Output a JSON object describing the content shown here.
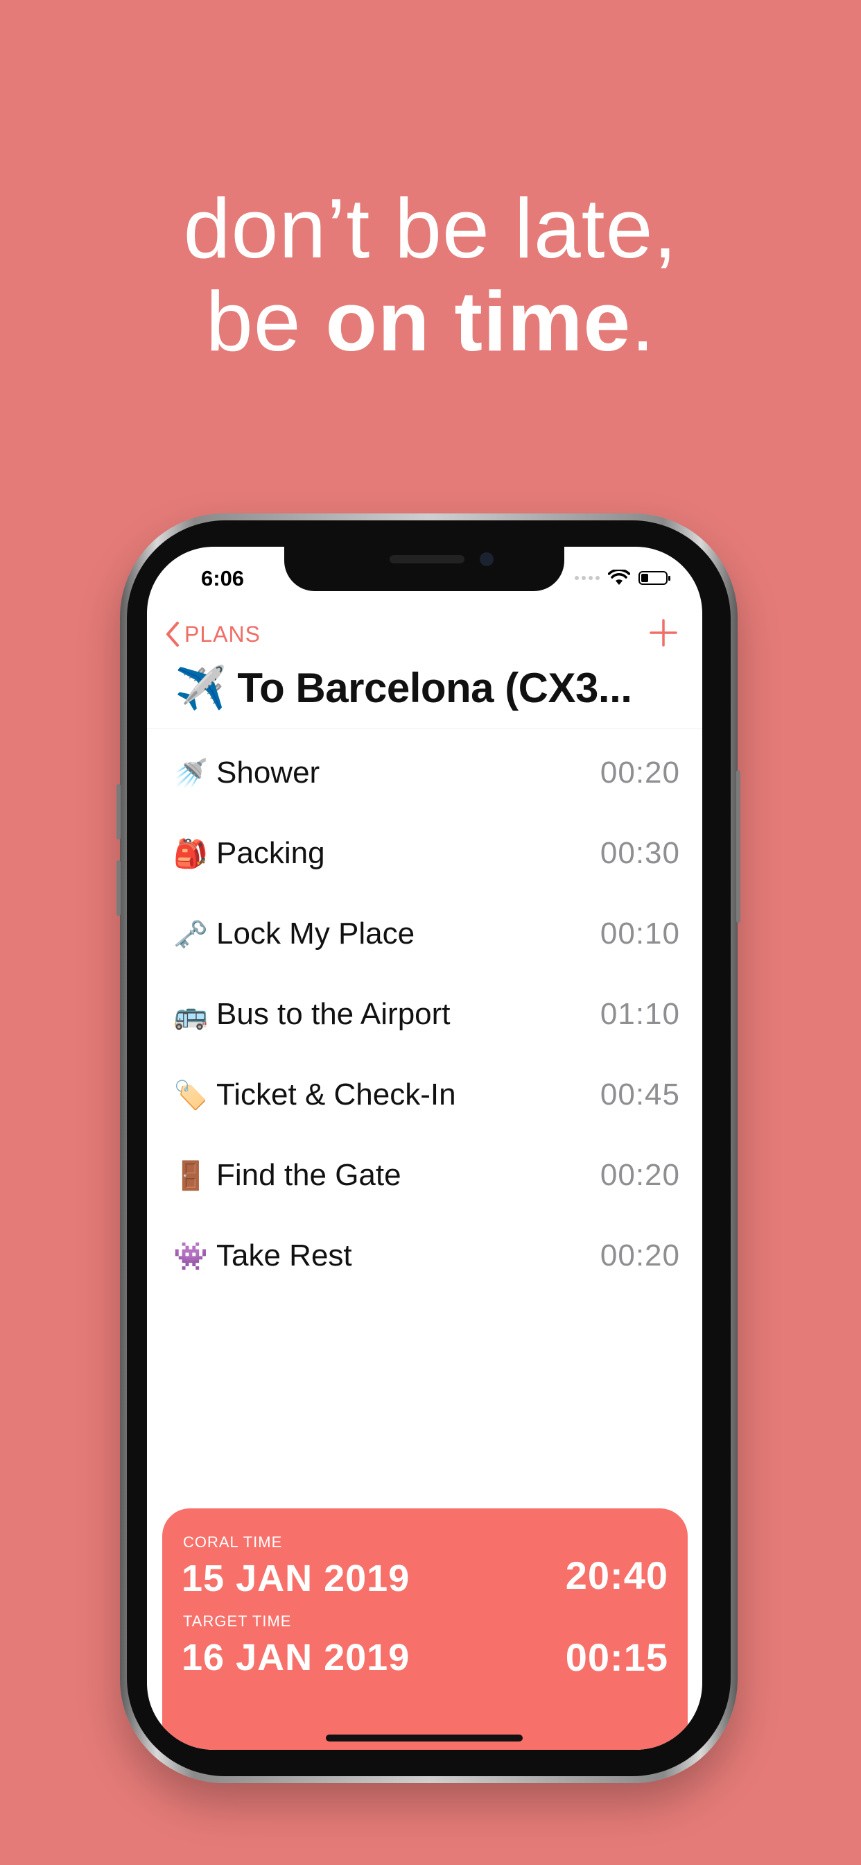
{
  "headline": {
    "line1": "don’t be late,",
    "line2_prefix": "be ",
    "line2_bold": "on time",
    "line2_suffix": "."
  },
  "status_bar": {
    "time": "6:06",
    "icons": [
      "cellular-signal-icon",
      "wifi-icon",
      "battery-icon"
    ]
  },
  "nav": {
    "back_label": "PLANS",
    "back_icon": "chevron-left-icon",
    "add_icon": "plus-icon"
  },
  "plan": {
    "emoji": "✈️",
    "title": "To Barcelona (CX3..."
  },
  "tasks": [
    {
      "emoji": "🚿",
      "label": "Shower",
      "duration": "00:20"
    },
    {
      "emoji": "🎒",
      "label": "Packing",
      "duration": "00:30"
    },
    {
      "emoji": "🗝️",
      "label": "Lock My Place",
      "duration": "00:10"
    },
    {
      "emoji": "🚌",
      "label": "Bus to the Airport",
      "duration": "01:10"
    },
    {
      "emoji": "🏷️",
      "label": "Ticket & Check-In",
      "duration": "00:45"
    },
    {
      "emoji": "🚪",
      "label": "Find the Gate",
      "duration": "00:20"
    },
    {
      "emoji": "👾",
      "label": "Take Rest",
      "duration": "00:20"
    }
  ],
  "summary": {
    "coral_label": "CORAL TIME",
    "coral_date": "15 JAN 2019",
    "coral_time": "20:40",
    "target_label": "TARGET TIME",
    "target_date": "16 JAN 2019",
    "target_time": "00:15"
  },
  "colors": {
    "background": "#e47b78",
    "accent": "#f06e66",
    "summary_card": "#f7706a",
    "duration_text": "#8e8e93"
  }
}
